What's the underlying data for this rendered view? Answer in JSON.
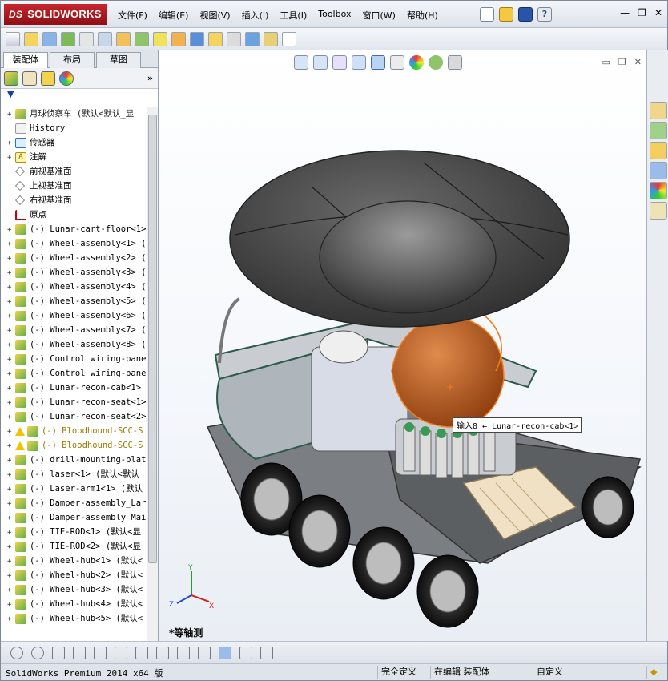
{
  "app": {
    "brand": "SOLIDWORKS",
    "brand_prefix": "DS",
    "menus": [
      "文件(F)",
      "编辑(E)",
      "视图(V)",
      "插入(I)",
      "工具(I)",
      "Toolbox",
      "窗口(W)",
      "帮助(H)"
    ],
    "window_buttons": [
      "—",
      "❐",
      "✕"
    ]
  },
  "left_panel": {
    "tabs": [
      "装配体",
      "布局",
      "草图"
    ],
    "active_tab": "装配体",
    "filter_symbol": "▼",
    "tree": [
      {
        "label": "月球侦察车  (默认<默认_显",
        "kind": "root"
      },
      {
        "label": "History",
        "kind": "history"
      },
      {
        "label": "传感器",
        "kind": "sensor"
      },
      {
        "label": "注解",
        "kind": "anno"
      },
      {
        "label": "前视基准面",
        "kind": "plane"
      },
      {
        "label": "上视基准面",
        "kind": "plane"
      },
      {
        "label": "右视基准面",
        "kind": "plane"
      },
      {
        "label": "原点",
        "kind": "origin"
      },
      {
        "label": "(-) Lunar-cart-floor<1>",
        "kind": "asm"
      },
      {
        "label": "(-) Wheel-assembly<1> (",
        "kind": "asm"
      },
      {
        "label": "(-) Wheel-assembly<2> (",
        "kind": "asm"
      },
      {
        "label": "(-) Wheel-assembly<3> (",
        "kind": "asm"
      },
      {
        "label": "(-) Wheel-assembly<4> (",
        "kind": "asm"
      },
      {
        "label": "(-) Wheel-assembly<5> (",
        "kind": "asm"
      },
      {
        "label": "(-) Wheel-assembly<6> (",
        "kind": "asm"
      },
      {
        "label": "(-) Wheel-assembly<7> (",
        "kind": "asm"
      },
      {
        "label": "(-) Wheel-assembly<8> (",
        "kind": "asm"
      },
      {
        "label": "(-) Control wiring-pane",
        "kind": "asm"
      },
      {
        "label": "(-) Control wiring-pane",
        "kind": "asm"
      },
      {
        "label": "(-) Lunar-recon-cab<1>",
        "kind": "asm"
      },
      {
        "label": "(-) Lunar-recon-seat<1>",
        "kind": "asm"
      },
      {
        "label": "(-) Lunar-recon-seat<2>",
        "kind": "asm"
      },
      {
        "label": "(-) Bloodhound-SCC-S",
        "kind": "warn"
      },
      {
        "label": "(-) Bloodhound-SCC-S",
        "kind": "warn"
      },
      {
        "label": "(-) drill-mounting-plat",
        "kind": "asm"
      },
      {
        "label": "(-) laser<1> (默认<默认",
        "kind": "asm"
      },
      {
        "label": "(-) Laser-arm1<1> (默认",
        "kind": "asm"
      },
      {
        "label": "(-) Damper-assembly_Lar",
        "kind": "asm"
      },
      {
        "label": "(-) Damper-assembly_Mai",
        "kind": "asm"
      },
      {
        "label": "(-) TIE-ROD<1> (默认<显",
        "kind": "asm"
      },
      {
        "label": "(-) TIE-ROD<2> (默认<显",
        "kind": "asm"
      },
      {
        "label": "(-) Wheel-hub<1> (默认<",
        "kind": "asm"
      },
      {
        "label": "(-) Wheel-hub<2> (默认<",
        "kind": "asm"
      },
      {
        "label": "(-) Wheel-hub<3> (默认<",
        "kind": "asm"
      },
      {
        "label": "(-) Wheel-hub<4> (默认<",
        "kind": "asm"
      },
      {
        "label": "(-) Wheel-hub<5> (默认<",
        "kind": "asm"
      }
    ]
  },
  "viewport": {
    "view_label": "*等轴测",
    "tooltip": "输入8 ← Lunar-recon-cab<1>",
    "triad_labels": {
      "x": "X",
      "y": "Y",
      "z": "Z"
    }
  },
  "status": {
    "version_text": "SolidWorks Premium 2014 x64 版",
    "definition": "完全定义",
    "editing": "在编辑 装配体",
    "custom": "自定义"
  },
  "colors": {
    "brand_red": "#b0171d",
    "canopy": "#3f3f3f",
    "cab_orange": "#b85a1a",
    "frame_green": "#2f5a4a"
  }
}
